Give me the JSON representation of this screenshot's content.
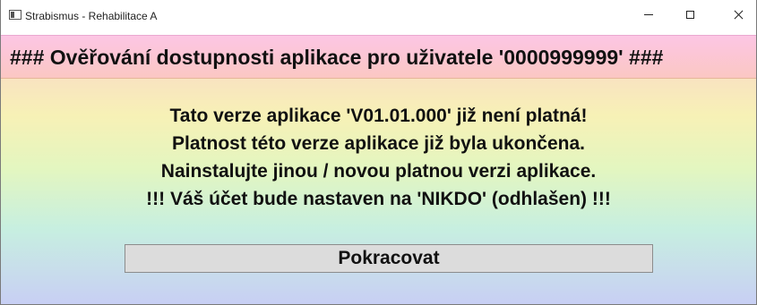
{
  "window": {
    "title": "Strabismus - Rehabilitace A",
    "icon": "app-window-icon",
    "controls": {
      "minimize_icon": "minimize-icon",
      "maximize_icon": "maximize-icon",
      "close_icon": "close-icon"
    }
  },
  "header": {
    "text": "### Ověřování dostupnosti aplikace pro uživatele '0000999999' ###"
  },
  "message": {
    "lines": [
      "Tato verze aplikace 'V01.01.000' již není platná!",
      "Platnost této verze aplikace již byla ukončena.",
      "Nainstalujte jinou / novou platnou verzi aplikace.",
      "!!! Váš účet bude nastaven na 'NIKDO' (odhlašen) !!!"
    ]
  },
  "actions": {
    "continue_label": "Pokracovat"
  },
  "colors": {
    "header_band": "#fcc6e4",
    "button_background": "#dcdcdc",
    "text": "#111111"
  }
}
